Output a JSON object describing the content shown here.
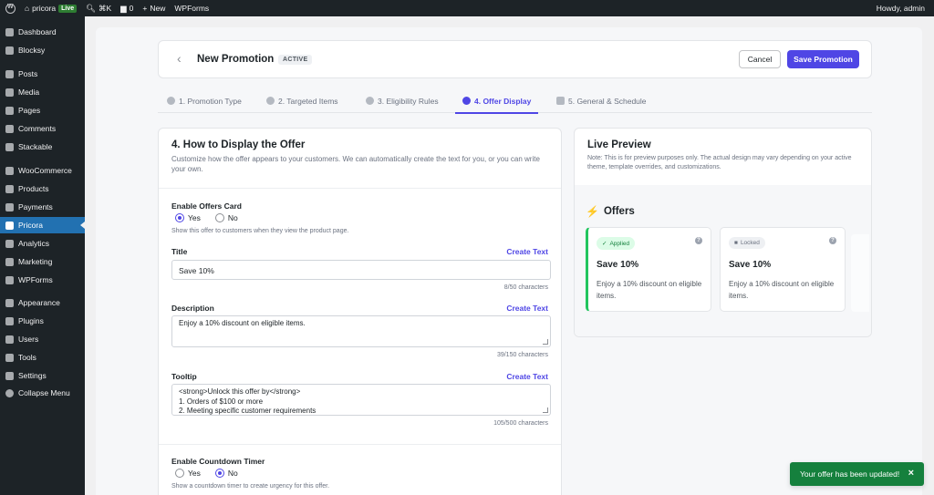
{
  "adminbar": {
    "site_name": "pricora",
    "live_badge": "Live",
    "shortcut": "⌘K",
    "comments_count": "0",
    "new_label": "New",
    "wpforms_label": "WPForms",
    "howdy": "Howdy, admin"
  },
  "sidebar": {
    "items": [
      {
        "label": "Dashboard",
        "icon": "dashboard-icon"
      },
      {
        "label": "Blocksy",
        "icon": "blocksy-icon"
      },
      {
        "label": "Posts",
        "icon": "pin-icon"
      },
      {
        "label": "Media",
        "icon": "media-icon"
      },
      {
        "label": "Pages",
        "icon": "page-icon"
      },
      {
        "label": "Comments",
        "icon": "comment-icon"
      },
      {
        "label": "Stackable",
        "icon": "stackable-icon"
      },
      {
        "label": "WooCommerce",
        "icon": "woocommerce-icon"
      },
      {
        "label": "Products",
        "icon": "products-icon"
      },
      {
        "label": "Payments",
        "icon": "payments-icon"
      },
      {
        "label": "Pricora",
        "icon": "pricora-icon",
        "active": true
      },
      {
        "label": "Analytics",
        "icon": "analytics-icon"
      },
      {
        "label": "Marketing",
        "icon": "megaphone-icon"
      },
      {
        "label": "WPForms",
        "icon": "wpforms-icon"
      },
      {
        "label": "Appearance",
        "icon": "brush-icon"
      },
      {
        "label": "Plugins",
        "icon": "plugin-icon"
      },
      {
        "label": "Users",
        "icon": "user-icon"
      },
      {
        "label": "Tools",
        "icon": "wrench-icon"
      },
      {
        "label": "Settings",
        "icon": "settings-icon"
      },
      {
        "label": "Collapse Menu",
        "icon": "collapse-icon"
      }
    ]
  },
  "header": {
    "title": "New Promotion",
    "status": "ACTIVE",
    "cancel_label": "Cancel",
    "save_label": "Save Promotion"
  },
  "tabs": [
    {
      "label": "1. Promotion Type"
    },
    {
      "label": "2. Targeted Items"
    },
    {
      "label": "3. Eligibility Rules"
    },
    {
      "label": "4. Offer Display",
      "active": true
    },
    {
      "label": "5. General & Schedule"
    }
  ],
  "form": {
    "title": "4. How to Display the Offer",
    "description": "Customize how the offer appears to your customers. We can automatically create the text for you, or you can write your own.",
    "enable_card_label": "Enable Offers Card",
    "yes": "Yes",
    "no": "No",
    "enable_card_help": "Show this offer to customers when they view the product page.",
    "title_label": "Title",
    "create_text": "Create Text",
    "title_value": "Save 10%",
    "title_counter": "8/50 characters",
    "description_label": "Description",
    "description_value": "Enjoy a 10% discount on eligible items.",
    "description_counter": "39/150 characters",
    "tooltip_label": "Tooltip",
    "tooltip_value": "<strong>Unlock this offer by</strong>\n1. Orders of $100 or more\n2. Meeting specific customer requirements",
    "tooltip_counter": "105/500 characters",
    "countdown_label": "Enable Countdown Timer",
    "countdown_help": "Show a countdown timer to create urgency for this offer."
  },
  "preview": {
    "title": "Live Preview",
    "note": "Note: This is for preview purposes only. The actual design may vary depending on your active theme, template overrides, and customizations.",
    "offers_heading": "Offers",
    "cards": [
      {
        "status": "Applied",
        "title": "Save 10%",
        "desc": "Enjoy a 10% discount on eligible items."
      },
      {
        "status": "Locked",
        "title": "Save 10%",
        "desc": "Enjoy a 10% discount on eligible items."
      }
    ]
  },
  "toast": {
    "message": "Your offer has been updated!",
    "close": "×"
  },
  "colors": {
    "accent": "#4f46e5",
    "wp_active": "#2271b1",
    "success": "#15803d"
  }
}
